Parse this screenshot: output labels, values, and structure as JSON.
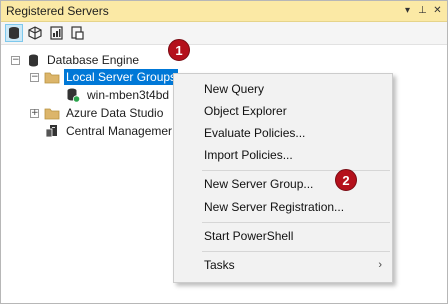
{
  "window": {
    "title": "Registered Servers"
  },
  "title_buttons": [
    {
      "name": "dropdown-arrow-icon",
      "glyph": "▾"
    },
    {
      "name": "pin-icon",
      "glyph": "⊥"
    },
    {
      "name": "close-icon",
      "glyph": "✕"
    }
  ],
  "tree": {
    "root": {
      "expander": "−",
      "label": "Database Engine"
    },
    "local_groups": {
      "expander": "−",
      "label": "Local Server Groups"
    },
    "server": {
      "label": "win-mben3t4bd"
    },
    "azure": {
      "expander": "+",
      "label": "Azure Data Studio"
    },
    "central": {
      "label": "Central Managemer"
    }
  },
  "badges": {
    "first": "1",
    "second": "2"
  },
  "context_menu": {
    "new_query": "New Query",
    "object_explorer": "Object Explorer",
    "evaluate_policies": "Evaluate Policies...",
    "import_policies": "Import Policies...",
    "new_server_group": "New Server Group...",
    "new_server_registration": "New Server Registration...",
    "start_powershell": "Start PowerShell",
    "tasks": "Tasks",
    "tasks_arrow": "›"
  },
  "colors": {
    "titlebar": "#fbe9a5",
    "selection": "#0078d7",
    "badge": "#b4101b"
  }
}
